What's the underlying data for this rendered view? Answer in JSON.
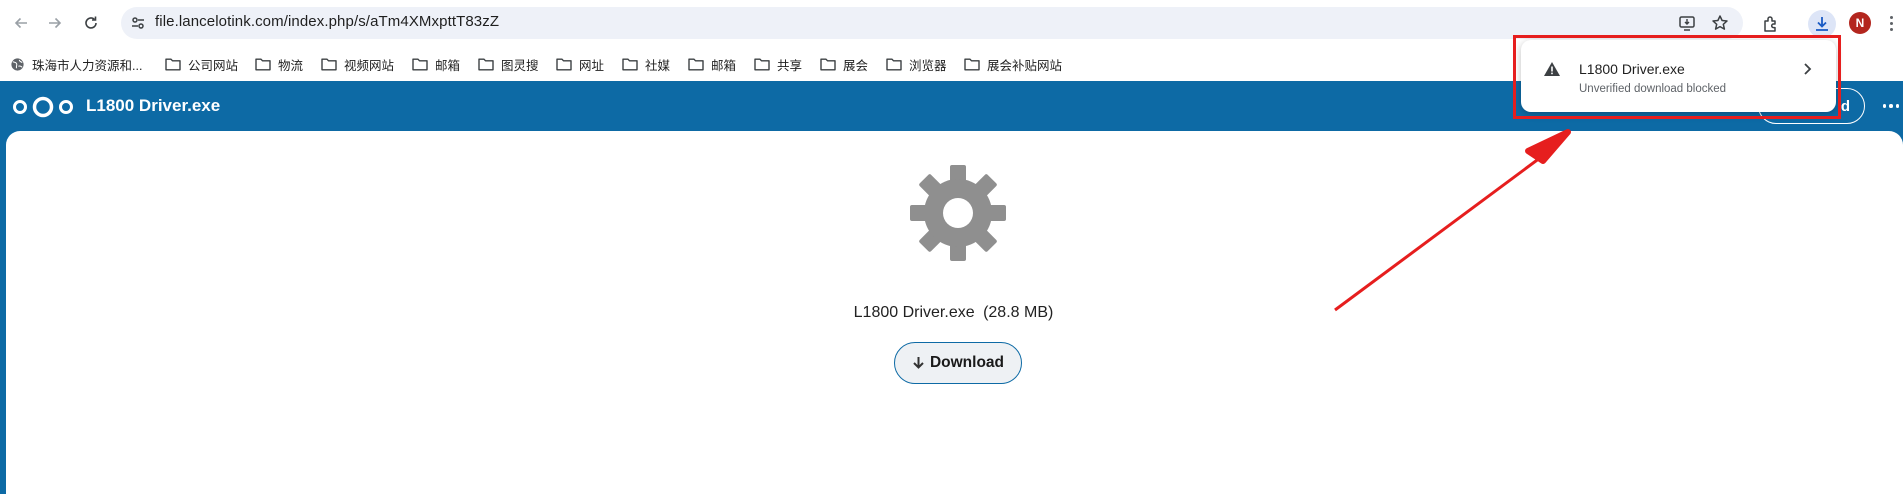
{
  "browser": {
    "url": "file.lancelotink.com/index.php/s/aTm4XMxpttT83zZ",
    "avatar_letter": "N",
    "avatar_color": "#b3261e"
  },
  "bookmarks": [
    {
      "label": "珠海市人力资源和...",
      "icon": "globe-icon"
    },
    {
      "label": "公司网站",
      "icon": "folder-icon"
    },
    {
      "label": "物流",
      "icon": "folder-icon"
    },
    {
      "label": "视频网站",
      "icon": "folder-icon"
    },
    {
      "label": "邮箱",
      "icon": "folder-icon"
    },
    {
      "label": "图灵搜",
      "icon": "folder-icon"
    },
    {
      "label": "网址",
      "icon": "folder-icon"
    },
    {
      "label": "社媒",
      "icon": "folder-icon"
    },
    {
      "label": "邮箱",
      "icon": "folder-icon"
    },
    {
      "label": "共享",
      "icon": "folder-icon"
    },
    {
      "label": "展会",
      "icon": "folder-icon"
    },
    {
      "label": "浏览器",
      "icon": "folder-icon"
    },
    {
      "label": "展会补贴网站",
      "icon": "folder-icon"
    }
  ],
  "nextcloud": {
    "title": "L1800 Driver.exe",
    "header_button_visible_text": "d",
    "brand_color": "#0d6aa5"
  },
  "file": {
    "name": "L1800 Driver.exe",
    "size": "(28.8 MB)",
    "download_label": "Download"
  },
  "download_bubble": {
    "filename": "L1800 Driver.exe",
    "status": "Unverified download blocked",
    "highlight_color": "#e61e1e"
  }
}
